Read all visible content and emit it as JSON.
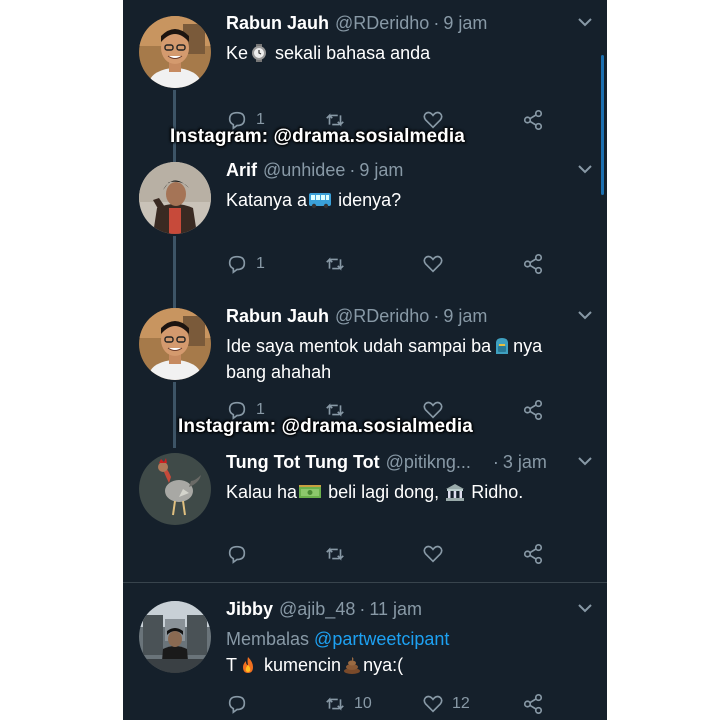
{
  "watermarks": [
    "Instagram: @drama.sosialmedia",
    "Instagram: @drama.sosialmedia"
  ],
  "tweets": [
    {
      "name": "Rabun Jauh",
      "handle": "@RDeridho",
      "separator": "·",
      "time": "9 jam",
      "text_parts": [
        "Ke",
        "sekali bahasa anda"
      ],
      "emoji": [
        "watch-emoji"
      ],
      "replies": "1",
      "retweets": "",
      "likes": ""
    },
    {
      "name": "Arif",
      "handle": "@unhidee",
      "separator": "·",
      "time": "9 jam",
      "text_parts": [
        "Katanya a",
        "idenya?"
      ],
      "emoji": [
        "bus-emoji"
      ],
      "replies": "1",
      "retweets": "",
      "likes": ""
    },
    {
      "name": "Rabun Jauh",
      "handle": "@RDeridho",
      "separator": "·",
      "time": "9 jam",
      "text_parts": [
        "Ide saya mentok udah sampai ba",
        "nya",
        "bang ahahah"
      ],
      "emoji": [
        "backpack-emoji"
      ],
      "replies": "1",
      "retweets": "",
      "likes": ""
    },
    {
      "name": "Tung Tot Tung Tot",
      "handle": "@pitikng...",
      "separator": "·",
      "time": "3 jam",
      "text_parts": [
        "Kalau ha",
        "beli lagi dong,",
        "Ridho."
      ],
      "emoji": [
        "cash-emoji",
        "bank-emoji"
      ],
      "replies": "",
      "retweets": "",
      "likes": ""
    },
    {
      "name": "Jibby",
      "handle": "@ajib_48",
      "separator": "·",
      "time": "11 jam",
      "reply_label": "Membalas",
      "reply_mention": "@partweetcipant",
      "text_parts": [
        "T",
        "kumencin",
        "nya:("
      ],
      "emoji": [
        "fire-emoji",
        "poop-emoji"
      ],
      "replies": "",
      "retweets": "10",
      "likes": "12"
    }
  ],
  "icons": {
    "reply": "reply-icon",
    "retweet": "retweet-icon",
    "like": "heart-icon",
    "share": "share-icon",
    "more": "chevron-down-icon"
  },
  "colors": {
    "background": "#15202b",
    "text": "#ffffff",
    "muted": "#8899a6",
    "link": "#1da1f2",
    "thread_line": "#3d5466"
  }
}
